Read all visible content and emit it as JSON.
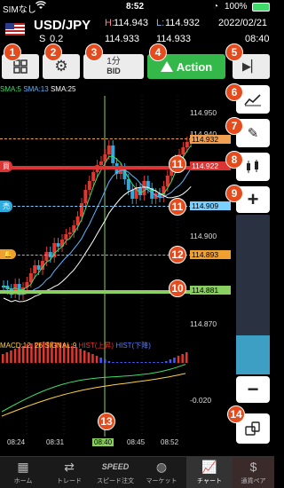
{
  "status": {
    "carrier": "SIMなし",
    "wifi": "wifi-icon",
    "time": "8:52",
    "battery": "100%"
  },
  "header": {
    "pair": "USD/JPY",
    "high_label": "H:",
    "high": "114.943",
    "low_label": "L:",
    "low": "114.932",
    "date": "2022/02/21",
    "spread_prefix": "S",
    "spread": "0.2",
    "bid": "114.933",
    "ask": "114.933",
    "clock": "08:40"
  },
  "toolbar": {
    "timeframe_top": "1分",
    "timeframe_bottom": "BID",
    "action_label": "Action"
  },
  "indicators": {
    "sma5": "SMA:5",
    "sma13": "SMA:13",
    "sma25": "SMA:25"
  },
  "price_labels": [
    "114.950",
    "114.940",
    "114.932",
    "114.922",
    "114.909",
    "114.900",
    "114.893",
    "114.881",
    "114.870",
    "-0.020"
  ],
  "markers": {
    "buy": "買",
    "sell": "売"
  },
  "macd": {
    "label": "MACD:12, 26",
    "signal": "SIGNAL:9",
    "up": "HIST(上昇)",
    "down": "HIST(下降)"
  },
  "time_axis": [
    "08:24",
    "08:31",
    "08:40",
    "08:45",
    "08:52"
  ],
  "badges": [
    "1",
    "2",
    "3",
    "4",
    "5",
    "6",
    "7",
    "8",
    "9",
    "10",
    "11",
    "11",
    "12",
    "13",
    "14"
  ],
  "nav": [
    {
      "label": "ホーム",
      "icon": "home-icon"
    },
    {
      "label": "トレード",
      "icon": "trade-icon"
    },
    {
      "label": "スピード注文",
      "icon": "speed-icon"
    },
    {
      "label": "マーケット",
      "icon": "market-icon"
    },
    {
      "label": "チャート",
      "icon": "chart-icon"
    },
    {
      "label": "通貨ペア",
      "icon": "currency-icon"
    }
  ],
  "colors": {
    "up": "#e5362e",
    "down": "#2eaadc",
    "action": "#35b84a",
    "badge": "#e54b1c",
    "sma5": "#3fdc6a",
    "sma13": "#5ab6ff",
    "sma25": "#ffffff"
  }
}
